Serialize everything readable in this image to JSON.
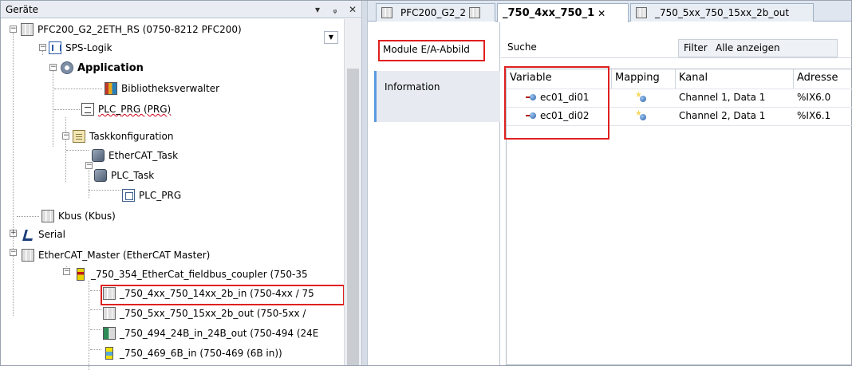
{
  "left_panel": {
    "title": "Geräte",
    "pin": "▾",
    "dock": "ᵩ",
    "close": "✕",
    "tree": [
      {
        "label": "PFC200_G2_2ETH_RS (0750-8212 PFC200)",
        "icon": "module-icon"
      },
      {
        "label": "SPS-Logik",
        "icon": "plc-logic-icon"
      },
      {
        "label": "Application",
        "icon": "application-icon"
      },
      {
        "label": "Bibliotheksverwalter",
        "icon": "library-icon"
      },
      {
        "label": "PLC_PRG (PRG)",
        "icon": "program-icon"
      },
      {
        "label": "Taskkonfiguration",
        "icon": "task-config-icon"
      },
      {
        "label": "EtherCAT_Task",
        "icon": "task-icon"
      },
      {
        "label": "PLC_Task",
        "icon": "task-icon"
      },
      {
        "label": "PLC_PRG",
        "icon": "program-call-icon"
      },
      {
        "label": "Kbus (Kbus)",
        "icon": "module-icon"
      },
      {
        "label": "Serial",
        "icon": "serial-icon"
      },
      {
        "label": "EtherCAT_Master (EtherCAT Master)",
        "icon": "module-icon"
      },
      {
        "label": "_750_354_EtherCat_fieldbus_coupler (750-35",
        "icon": "coupler-icon"
      },
      {
        "label": "_750_4xx_750_14xx_2b_in (750-4xx / 75",
        "icon": "module-icon"
      },
      {
        "label": "_750_5xx_750_15xx_2b_out (750-5xx /",
        "icon": "module-icon"
      },
      {
        "label": "_750_494_24B_in_24B_out (750-494 (24E",
        "icon": "power-module-icon"
      },
      {
        "label": "_750_469_6B_in (750-469 (6B in))",
        "icon": "analog-module-icon"
      }
    ]
  },
  "editor": {
    "tabs": [
      {
        "label": "PFC200_G2_2",
        "active": false
      },
      {
        "label": "_750_4xx_750_1",
        "active": true,
        "close": "✕"
      },
      {
        "label": "_750_5xx_750_15xx_2b_out",
        "active": false
      }
    ],
    "side_tabs": [
      {
        "label": "Module E/A-Abbild"
      },
      {
        "label": "Information"
      }
    ],
    "search": {
      "label": "Suche",
      "value": ""
    },
    "filter": {
      "label": "Filter",
      "value": "Alle anzeigen"
    },
    "table": {
      "columns": [
        "Variable",
        "Mapping",
        "Kanal",
        "Adresse"
      ],
      "rows": [
        {
          "variable": "ec01_di01",
          "kanal": "Channel 1, Data 1",
          "adresse": "%IX6.0"
        },
        {
          "variable": "ec01_di02",
          "kanal": "Channel 2, Data 1",
          "adresse": "%IX6.1"
        }
      ]
    }
  },
  "colors": {
    "highlight_box": "#e02020",
    "accent": "#5a9ae0",
    "panel_header": "#e9edf3"
  }
}
